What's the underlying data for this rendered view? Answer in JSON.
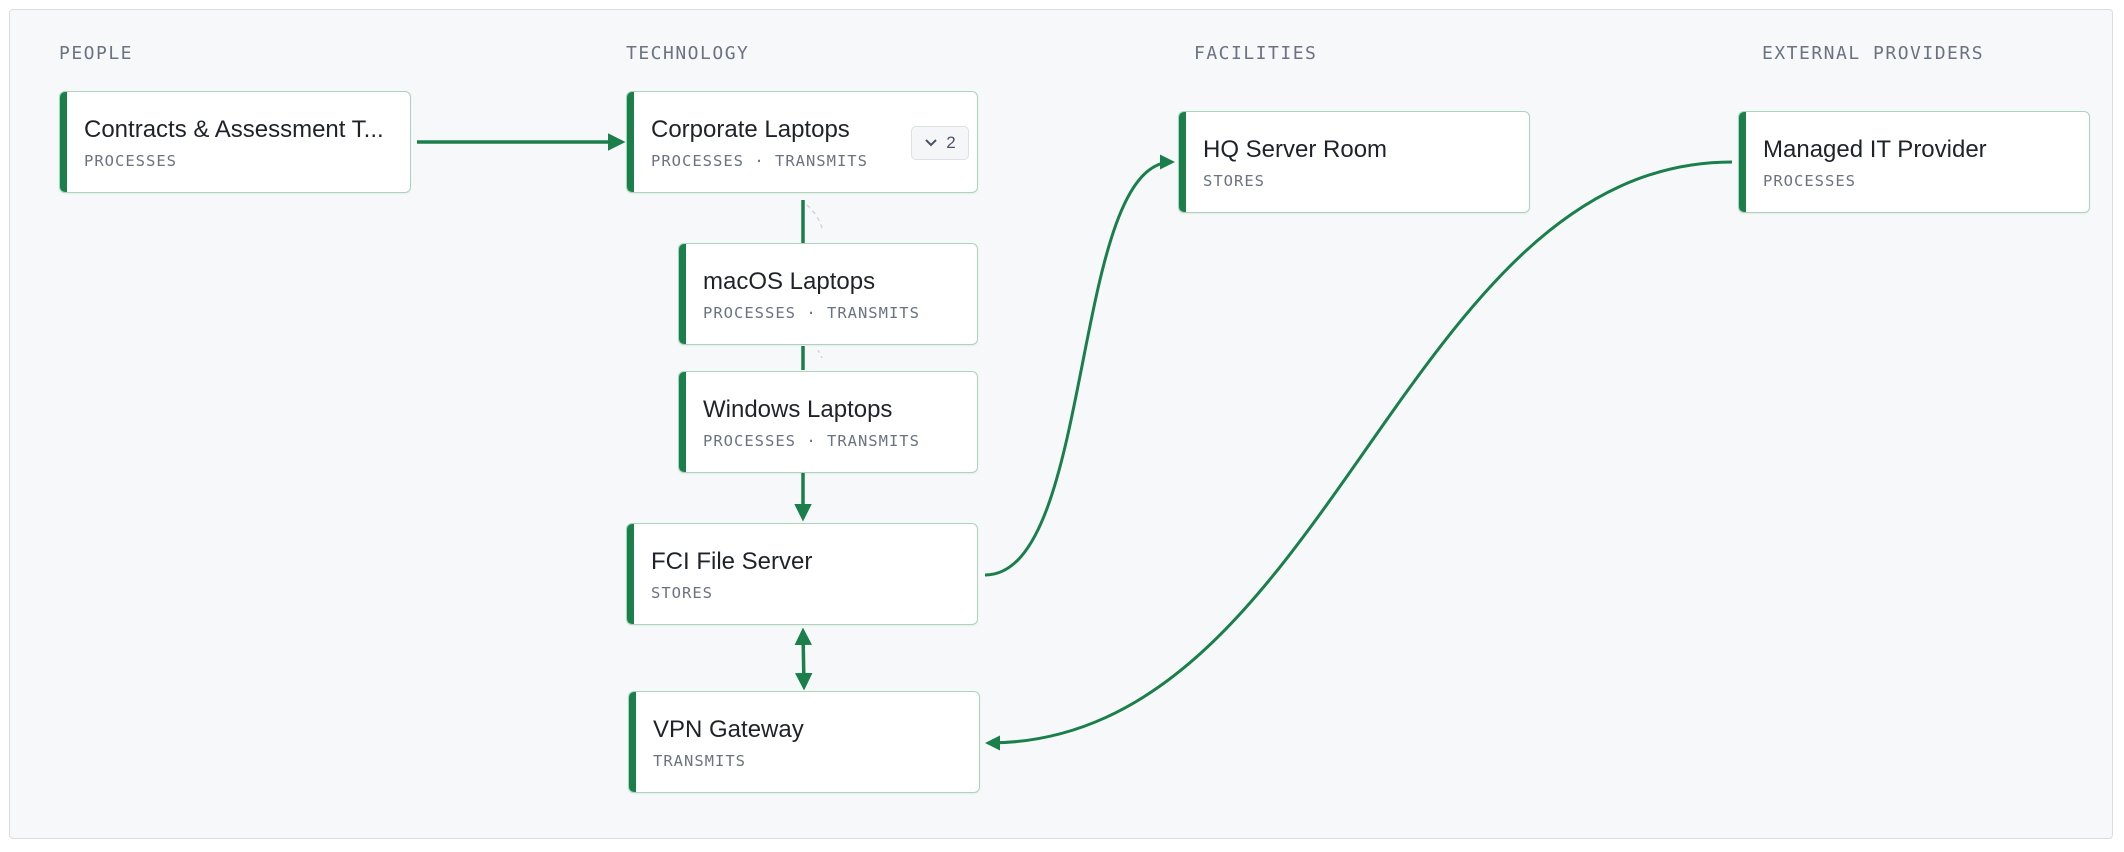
{
  "columns": [
    {
      "title": "PEOPLE"
    },
    {
      "title": "TECHNOLOGY"
    },
    {
      "title": "FACILITIES"
    },
    {
      "title": "EXTERNAL PROVIDERS"
    }
  ],
  "nodes": {
    "contracts": {
      "name": "Contracts & Assessment T...",
      "roles": "PROCESSES"
    },
    "corporate_laptops": {
      "name": "Corporate Laptops",
      "roles": "PROCESSES · TRANSMITS",
      "child_count": "2"
    },
    "macos_laptops": {
      "name": "macOS Laptops",
      "roles": "PROCESSES · TRANSMITS"
    },
    "windows_laptops": {
      "name": "Windows Laptops",
      "roles": "PROCESSES · TRANSMITS"
    },
    "fci_file_server": {
      "name": "FCI File Server",
      "roles": "STORES"
    },
    "vpn_gateway": {
      "name": "VPN Gateway",
      "roles": "TRANSMITS"
    },
    "hq_server_room": {
      "name": "HQ Server Room",
      "roles": "STORES"
    },
    "managed_it": {
      "name": "Managed IT Provider",
      "roles": "PROCESSES"
    }
  },
  "colors": {
    "accent": "#1a7f4b",
    "node_border": "#a9d5bb",
    "canvas_bg": "#f7f8fa"
  }
}
